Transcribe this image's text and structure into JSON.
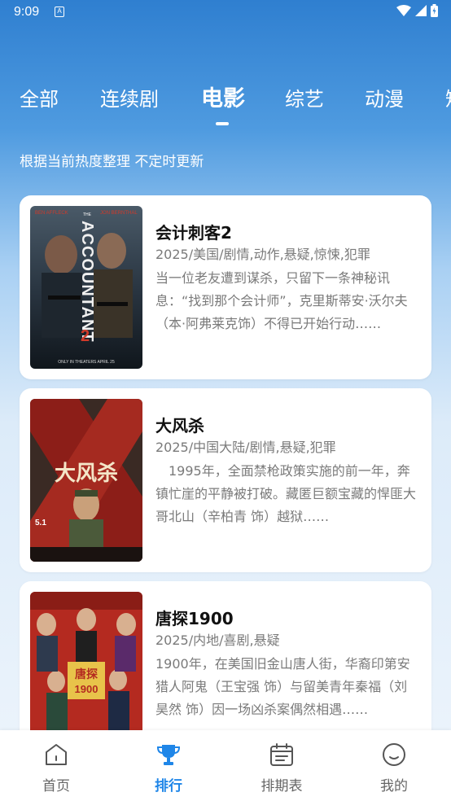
{
  "status": {
    "time": "9:09",
    "notif": "A"
  },
  "tabs": [
    {
      "label": "全部"
    },
    {
      "label": "连续剧"
    },
    {
      "label": "电影"
    },
    {
      "label": "综艺"
    },
    {
      "label": "动漫"
    },
    {
      "label": "短"
    }
  ],
  "subtitle": "根据当前热度整理 不定时更新",
  "cards": [
    {
      "title": "会计刺客2",
      "meta": "2025/美国/剧情,动作,悬疑,惊悚,犯罪",
      "desc": "当一位老友遭到谋杀，只留下一条神秘讯息：“找到那个会计师”，克里斯蒂安·沃尔夫（本·阿弗莱克饰）不得已开始行动……",
      "poster": {
        "top_text": "BEN AFFLECK   THE   JON BERNTHAL",
        "big_text": "ACCOUNTANT",
        "num": "2",
        "bottom": "ONLY IN THEATERS APRIL 25",
        "color": "#233140"
      }
    },
    {
      "title": "大风杀",
      "meta": "2025/中国大陆/剧情,悬疑,犯罪",
      "desc": "　1995年，全面禁枪政策实施的前一年，奔镇忙崖的平静被打破。藏匿巨额宝藏的悍匪大哥北山（辛柏青 饰）越狱……",
      "poster": {
        "big_text": "大风杀",
        "date": "5.1",
        "color": "#7a1d18"
      }
    },
    {
      "title": "唐探1900",
      "meta": "2025/内地/喜剧,悬疑",
      "desc": "1900年，在美国旧金山唐人街，华裔印第安猎人阿鬼（王宝强 饰）与留美青年秦福（刘昊然 饰）因一场凶杀案偶然相遇……",
      "poster": {
        "big_text": "唐探1900",
        "color": "#b8261c"
      }
    }
  ],
  "nav": [
    {
      "label": "首页",
      "icon": "home-icon"
    },
    {
      "label": "排行",
      "icon": "trophy-icon"
    },
    {
      "label": "排期表",
      "icon": "calendar-icon"
    },
    {
      "label": "我的",
      "icon": "smile-icon"
    }
  ],
  "colors": {
    "accent": "#1f86e8",
    "bg_top": "#2f7fd0",
    "bg_bottom": "#eef5fc"
  }
}
